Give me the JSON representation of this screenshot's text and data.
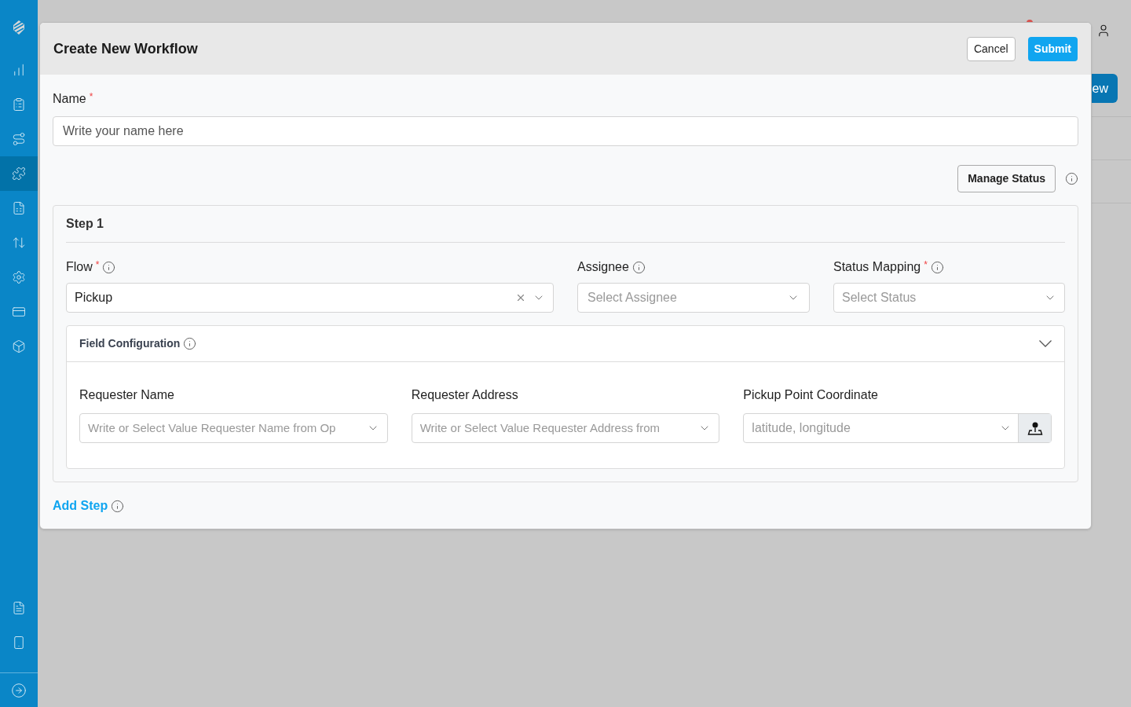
{
  "sidebar": {
    "items": [
      {
        "kind": "chart",
        "selected": false
      },
      {
        "kind": "clipboard",
        "selected": false
      },
      {
        "kind": "route",
        "selected": false
      },
      {
        "kind": "puzzle",
        "selected": true
      },
      {
        "kind": "sheet",
        "selected": false
      },
      {
        "kind": "swap",
        "selected": false
      },
      {
        "kind": "gear",
        "selected": false
      },
      {
        "kind": "card",
        "selected": false
      },
      {
        "kind": "box",
        "selected": false
      }
    ],
    "bottom_items": [
      {
        "kind": "file",
        "selected": false
      },
      {
        "kind": "phone",
        "selected": false
      }
    ]
  },
  "background": {
    "new_button": "ew"
  },
  "dialog": {
    "title": "Create New Workflow",
    "cancel": "Cancel",
    "submit": "Submit",
    "name": {
      "label": "Name",
      "required_mark": "*",
      "placeholder": "Write your name here"
    },
    "manage_status": "Manage Status",
    "steps": [
      {
        "title": "Step 1",
        "flow": {
          "label": "Flow",
          "required_mark": "*",
          "value": "Pickup"
        },
        "assignee": {
          "label": "Assignee",
          "placeholder": "Select Assignee"
        },
        "status_mapping": {
          "label": "Status Mapping",
          "required_mark": "*",
          "placeholder": "Select Status"
        },
        "field_configuration": {
          "title": "Field Configuration",
          "expanded": true,
          "fields": [
            {
              "kind": "select",
              "label": "Requester Name",
              "placeholder": "Write or Select Value Requester Name from Op"
            },
            {
              "kind": "select",
              "label": "Requester Address",
              "placeholder": "Write or Select Value Requester Address from"
            },
            {
              "kind": "location",
              "label": "Pickup Point Coordinate",
              "placeholder": "latitude, longitude"
            }
          ]
        }
      }
    ],
    "add_step": "Add Step"
  }
}
